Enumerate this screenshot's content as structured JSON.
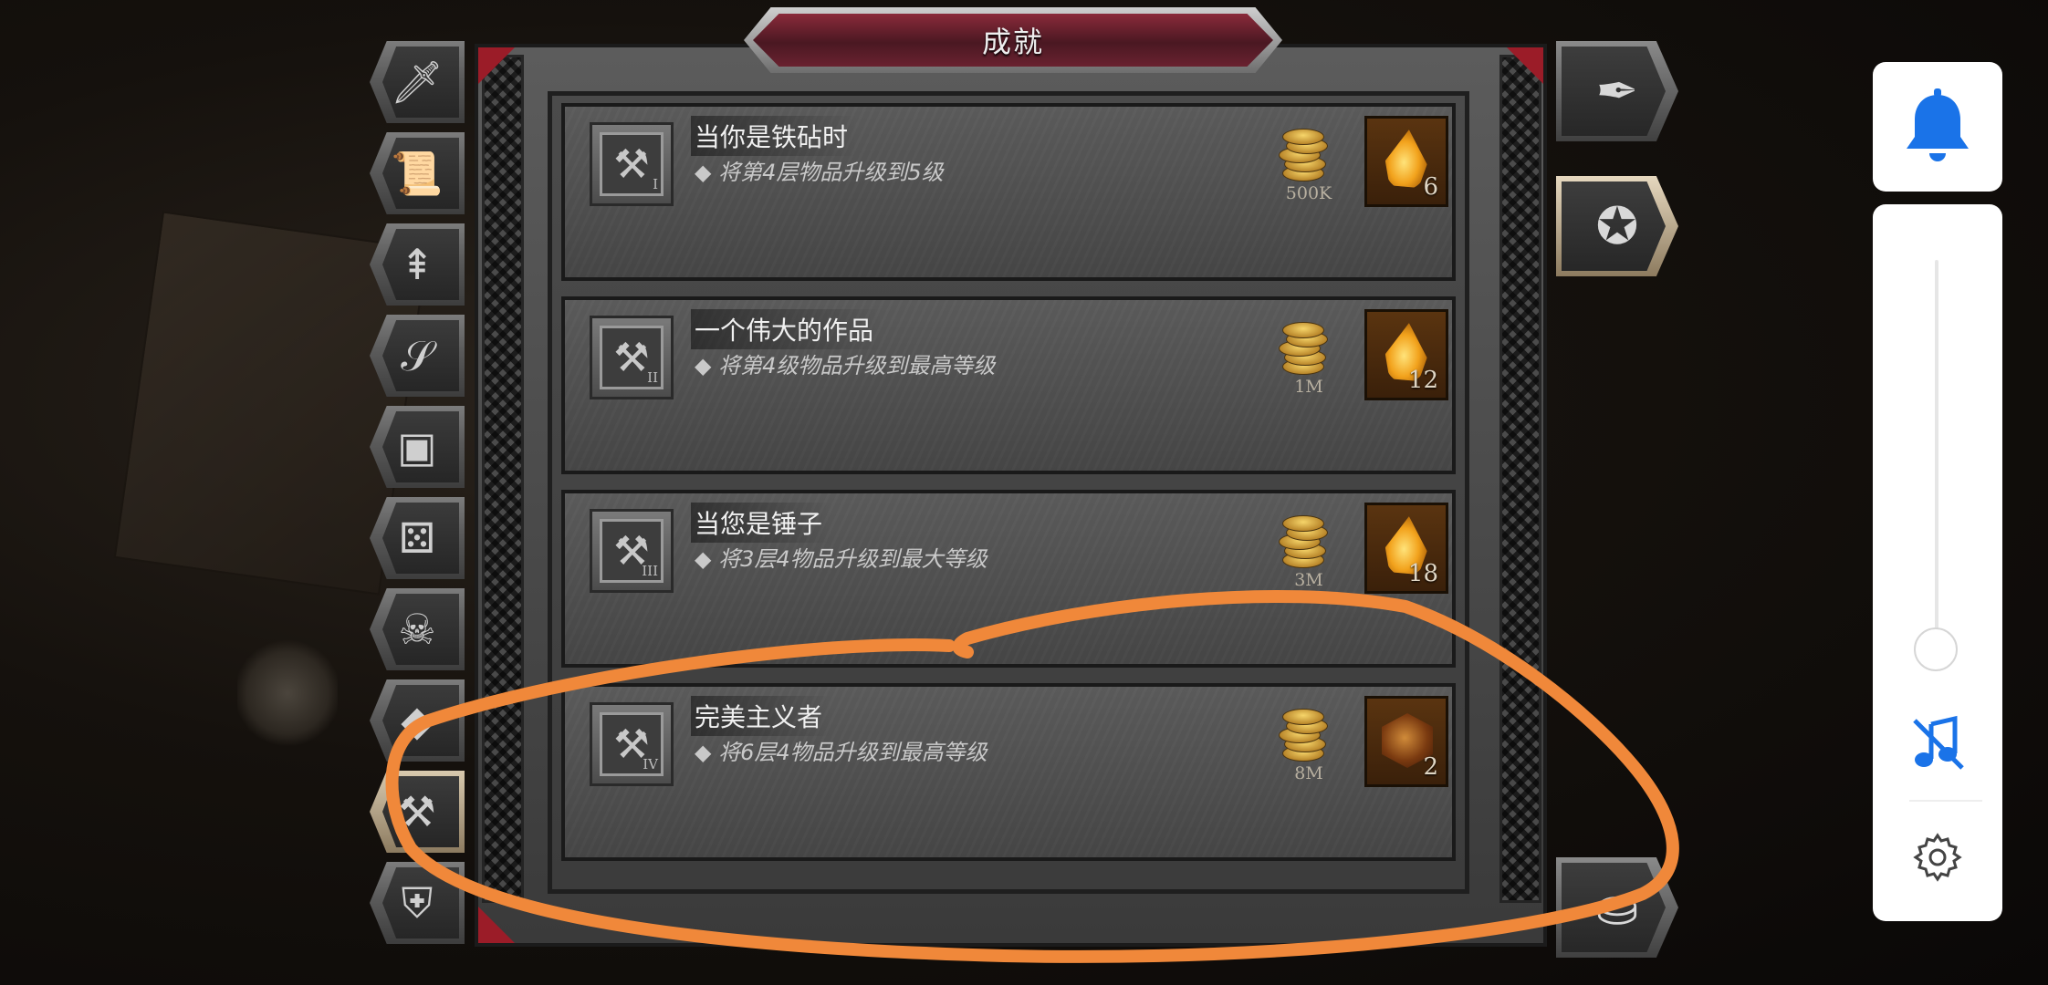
{
  "window": {
    "title": "成就"
  },
  "left_tabs": [
    {
      "icon": "sword-icon",
      "glyph": "🗡",
      "active": false
    },
    {
      "icon": "scroll-icon",
      "glyph": "📜",
      "active": false
    },
    {
      "icon": "winged-arrow-icon",
      "glyph": "⇞",
      "active": false
    },
    {
      "icon": "horn-icon",
      "glyph": "𝒮",
      "active": false
    },
    {
      "icon": "treasure-chest-icon",
      "glyph": "▣",
      "active": false
    },
    {
      "icon": "dice-icon",
      "glyph": "⚄",
      "active": false
    },
    {
      "icon": "horned-skull-icon",
      "glyph": "☠",
      "active": false
    },
    {
      "icon": "crystal-icon",
      "glyph": "◆",
      "active": false
    },
    {
      "icon": "hammer-icon",
      "glyph": "⚒",
      "active": true
    },
    {
      "icon": "armor-icon",
      "glyph": "⛨",
      "active": false
    }
  ],
  "right_tabs": [
    {
      "icon": "feather-quill-icon",
      "glyph": "✒",
      "active": false
    },
    {
      "icon": "laurel-star-icon",
      "glyph": "✪",
      "active": true
    },
    {
      "icon": "pouch-icon",
      "glyph": "⛀",
      "active": false
    }
  ],
  "achievements": [
    {
      "name": "当你是铁砧时",
      "desc": "◆ 将第4层物品升级到5级",
      "rank": "I",
      "gold": "500K",
      "reward_icon": "amber-gem-icon",
      "reward_count": "6"
    },
    {
      "name": "一个伟大的作品",
      "desc": "◆ 将第4级物品升级到最高等级",
      "rank": "II",
      "gold": "1M",
      "reward_icon": "amber-gem-icon",
      "reward_count": "12"
    },
    {
      "name": "当您是锤子",
      "desc": "◆ 将3层4物品升级到最大等级",
      "rank": "III",
      "gold": "3M",
      "reward_icon": "amber-gem-icon",
      "reward_count": "18"
    },
    {
      "name": "完美主义者",
      "desc": "◆ 将6层4物品升级到最高等级",
      "rank": "IV",
      "gold": "8M",
      "reward_icon": "orange-crystal-icon",
      "reward_count": "2"
    }
  ],
  "system_panel": {
    "notification_icon": "bell-icon",
    "music_icon": "music-off-icon",
    "settings_icon": "gear-icon",
    "volume_level": 0.08,
    "accent_color": "#1a73e8"
  },
  "annotation": {
    "color": "#f0883a",
    "shape": "hand-drawn-ellipse"
  }
}
